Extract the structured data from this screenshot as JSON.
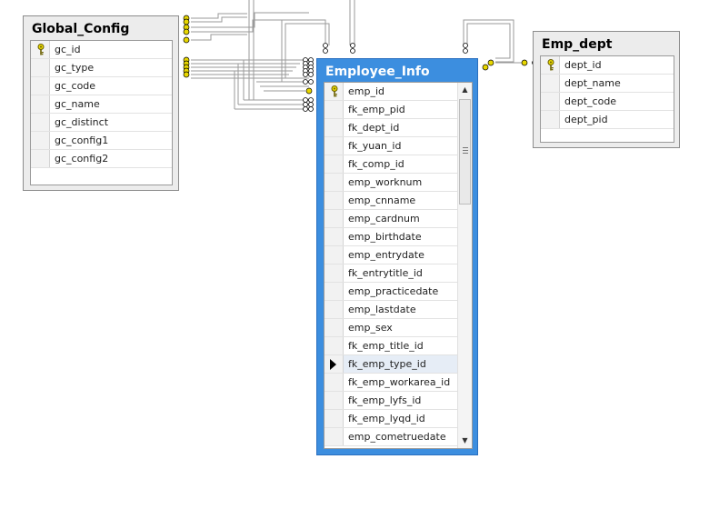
{
  "tables": {
    "global_config": {
      "title": "Global_Config",
      "columns": [
        "gc_id",
        "gc_type",
        "gc_code",
        "gc_name",
        "gc_distinct",
        "gc_config1",
        "gc_config2"
      ]
    },
    "employee_info": {
      "title": "Employee_Info",
      "columns": [
        "emp_id",
        "fk_emp_pid",
        "fk_dept_id",
        "fk_yuan_id",
        "fk_comp_id",
        "emp_worknum",
        "emp_cnname",
        "emp_cardnum",
        "emp_birthdate",
        "emp_entrydate",
        "fk_entrytitle_id",
        "emp_practicedate",
        "emp_lastdate",
        "emp_sex",
        "fk_emp_title_id",
        "fk_emp_type_id",
        "fk_emp_workarea_id",
        "fk_emp_lyfs_id",
        "fk_emp_lyqd_id",
        "emp_cometruedate"
      ]
    },
    "emp_dept": {
      "title": "Emp_dept",
      "columns": [
        "dept_id",
        "dept_name",
        "dept_code",
        "dept_pid"
      ]
    }
  },
  "colors": {
    "selected_header": "#3c8edf",
    "key_icon": "#d9c200",
    "connector": "#9a9a9a"
  },
  "icons": {
    "key": "primary-key-icon",
    "row_pointer": "row-pointer-icon",
    "relationship": "relationship-line"
  }
}
